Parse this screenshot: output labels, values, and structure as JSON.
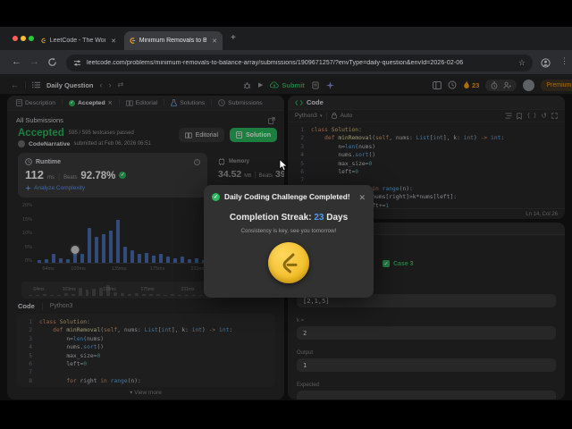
{
  "colors": {
    "green": "#2cbb5d",
    "orange": "#ffa116",
    "blue": "#4a9df5",
    "bar_blue": "#4a6fb5"
  },
  "browser": {
    "tabs": [
      {
        "title": "LeetCode - The World's Lea"
      },
      {
        "title": "Minimum Removals to Balan"
      }
    ],
    "url": "leetcode.com/problems/minimum-removals-to-balance-array/submissions/1909671257/?envType=daily-question&envId=2026-02-06"
  },
  "nav": {
    "daily_question": "Daily Question",
    "submit_label": "Submit",
    "streak_count": "23",
    "premium_label": "Premium"
  },
  "left_tabs": {
    "description": "Description",
    "accepted": "Accepted",
    "editorial": "Editorial",
    "solutions": "Solutions",
    "submissions": "Submissions"
  },
  "submission": {
    "panel_title": "All Submissions",
    "status": "Accepted",
    "testcases": "595 / 595 testcases passed",
    "author": "CodeNarrative",
    "submitted": "submitted at Feb 06, 2026 06:51",
    "editorial_button": "Editorial",
    "solution_button": "Solution",
    "runtime": {
      "label": "Runtime",
      "value": "112",
      "unit": "ms",
      "beats_label": "Beats",
      "beats": "92.78%",
      "analyze": "Analyze Complexity"
    },
    "memory": {
      "label": "Memory",
      "value": "34.52",
      "unit": "MB",
      "beats_label": "Beats",
      "beats": "39.35%"
    }
  },
  "chart_data": {
    "type": "bar",
    "title": "Runtime distribution histogram",
    "ylabel": "percent of submissions",
    "y_ticks": [
      "20%",
      "15%",
      "10%",
      "5%",
      "0%"
    ],
    "x_ticks": [
      "64ms",
      "103ms",
      "139ms",
      "175ms",
      "211ms"
    ],
    "x_tick_pos_pct": [
      2,
      17,
      34,
      50,
      67
    ],
    "values": [
      1,
      1.2,
      2.9,
      1.5,
      1.2,
      4.4,
      3,
      11.8,
      8.8,
      9.8,
      10.8,
      14.7,
      5.4,
      4.4,
      2.9,
      3.4,
      2.5,
      2.9,
      2,
      1.5,
      2,
      1.2,
      1.5,
      1,
      1.2,
      0.8,
      1,
      0.6,
      0.8,
      1.2,
      0.5,
      0.8,
      0.6,
      1.4
    ],
    "marker_index": 5,
    "ylim": [
      0,
      20
    ]
  },
  "code_section": {
    "tab_code": "Code",
    "tab_lang": "Python3",
    "view_more": "View more",
    "lines": [
      "class Solution:",
      "    def minRemoval(self, nums: List[int], k: int) -> int:",
      "        n=len(nums)",
      "        nums.sort()",
      "        max_size=0",
      "        left=0",
      "",
      "        for right in range(n):"
    ]
  },
  "editor": {
    "header": "Code",
    "lang": "Python3",
    "auto_label": "Auto",
    "status": "Ln 14, Col 26",
    "lines": [
      "class Solution:",
      "    def minRemoval(self, nums: List[int], k: int) -> int:",
      "        n=len(nums)",
      "        nums.sort()",
      "        max_size=0",
      "        left=0",
      "",
      "        for right in range(n):",
      "            while nums[right]>k*nums[left]:",
      "                left+=1"
    ]
  },
  "testcase": {
    "case_label": "Case 3",
    "fields": [
      {
        "label": "nums =",
        "value": "[2,1,5]"
      },
      {
        "label": "k =",
        "value": "2"
      },
      {
        "label": "Output",
        "value": "1"
      },
      {
        "label": "Expected",
        "value": ""
      }
    ]
  },
  "modal": {
    "title": "Daily Coding Challenge Completed!",
    "streak_label": "Completion Streak:",
    "streak_value": "23",
    "streak_unit": "Days",
    "subtitle": "Consistency is key, see you tomorrow!"
  }
}
